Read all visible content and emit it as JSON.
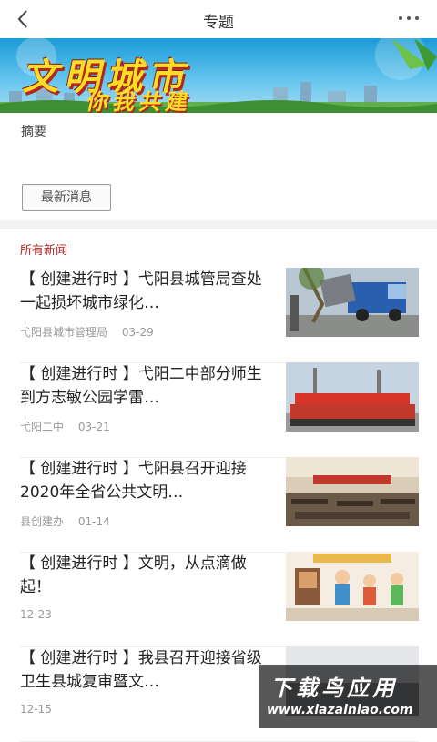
{
  "header": {
    "title": "专题",
    "back_icon": "back-arrow-icon",
    "more_icon": "more-dots-icon"
  },
  "banner": {
    "line1": "文明城市",
    "line2": "你我共建"
  },
  "summary_label": "摘要",
  "latest_button": "最新消息",
  "section_title": "所有新闻",
  "news": [
    {
      "title": "【 创建进行时 】弋阳县城管局查处一起损坏城市绿化…",
      "source": "弋阳县城市管理局",
      "date": "03-29"
    },
    {
      "title": "【 创建进行时 】弋阳二中部分师生到方志敏公园学雷…",
      "source": "弋阳二中",
      "date": "03-21"
    },
    {
      "title": "【 创建进行时 】弋阳县召开迎接2020年全省公共文明…",
      "source": "县创建办",
      "date": "01-14"
    },
    {
      "title": "【 创建进行时 】文明，从点滴做起！",
      "source": "",
      "date": "12-23"
    },
    {
      "title": "【 创建进行时 】我县召开迎接省级卫生县城复审暨文…",
      "source": "",
      "date": "12-15"
    }
  ],
  "watermark": {
    "line1": "下载鸟应用",
    "line2": "www.xiazainiao.com"
  },
  "colors": {
    "section": "#b52020",
    "divider": "#f2f2f2",
    "banner_text": "#ffdc27"
  }
}
